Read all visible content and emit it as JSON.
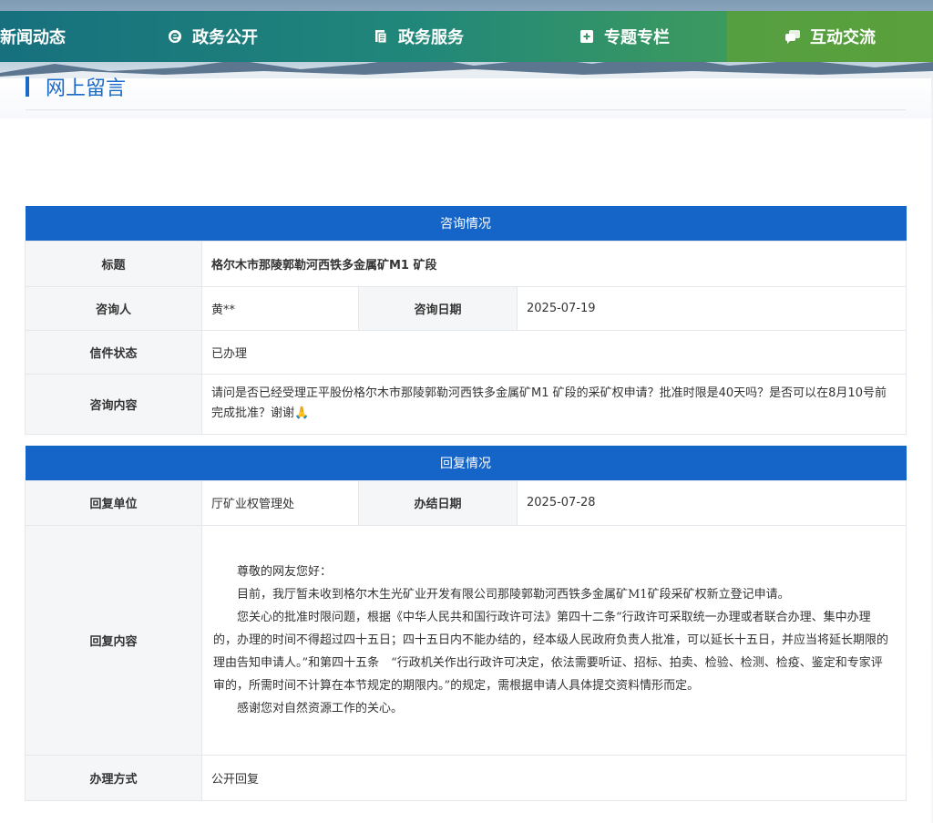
{
  "nav": {
    "items": [
      {
        "label": "新闻动态",
        "icon": ""
      },
      {
        "label": "政务公开",
        "icon": "e-icon"
      },
      {
        "label": "政务服务",
        "icon": "document-icon"
      },
      {
        "label": "专题专栏",
        "icon": "plus-square-icon"
      },
      {
        "label": "互动交流",
        "icon": "chat-icon"
      }
    ]
  },
  "section": {
    "title": "网上留言"
  },
  "consult": {
    "header": "咨询情况",
    "title_label": "标题",
    "title_value": "格尔木市那陵郭勒河西铁多金属矿M1 矿段",
    "person_label": "咨询人",
    "person_value": "黄**",
    "date_label": "咨询日期",
    "date_value": "2025-07-19",
    "status_label": "信件状态",
    "status_value": "已办理",
    "content_label": "咨询内容",
    "content_value": "请问是否已经受理正平股份格尔木市那陵郭勒河西铁多金属矿M1 矿段的采矿权申请？批准时限是40天吗？是否可以在8月10号前完成批准？谢谢🙏"
  },
  "reply": {
    "header": "回复情况",
    "unit_label": "回复单位",
    "unit_value": "厅矿业权管理处",
    "date_label": "办结日期",
    "date_value": "2025-07-28",
    "content_label": "回复内容",
    "paragraphs": [
      "尊敬的网友您好：",
      "目前，我厅暂未收到格尔木生光矿业开发有限公司那陵郭勒河西铁多金属矿M1矿段采矿权新立登记申请。",
      "您关心的批准时限问题，根据《中华人民共和国行政许可法》第四十二条“行政许可采取统一办理或者联合办理、集中办理的，办理的时间不得超过四十五日；四十五日内不能办结的，经本级人民政府负责人批准，可以延长十五日，并应当将延长期限的理由告知申请人。”和第四十五条　“行政机关作出行政许可决定，依法需要听证、招标、拍卖、检验、检测、检疫、鉴定和专家评审的，所需时间不计算在本节规定的期限内。”的规定，需根据申请人具体提交资料情形而定。",
      "感谢您对自然资源工作的关心。"
    ],
    "method_label": "办理方式",
    "method_value": "公开回复"
  },
  "colors": {
    "nav_start": "#16707e",
    "nav_end": "#5ba43e",
    "bar": "#1565c8",
    "accent": "#1a6bc7"
  }
}
